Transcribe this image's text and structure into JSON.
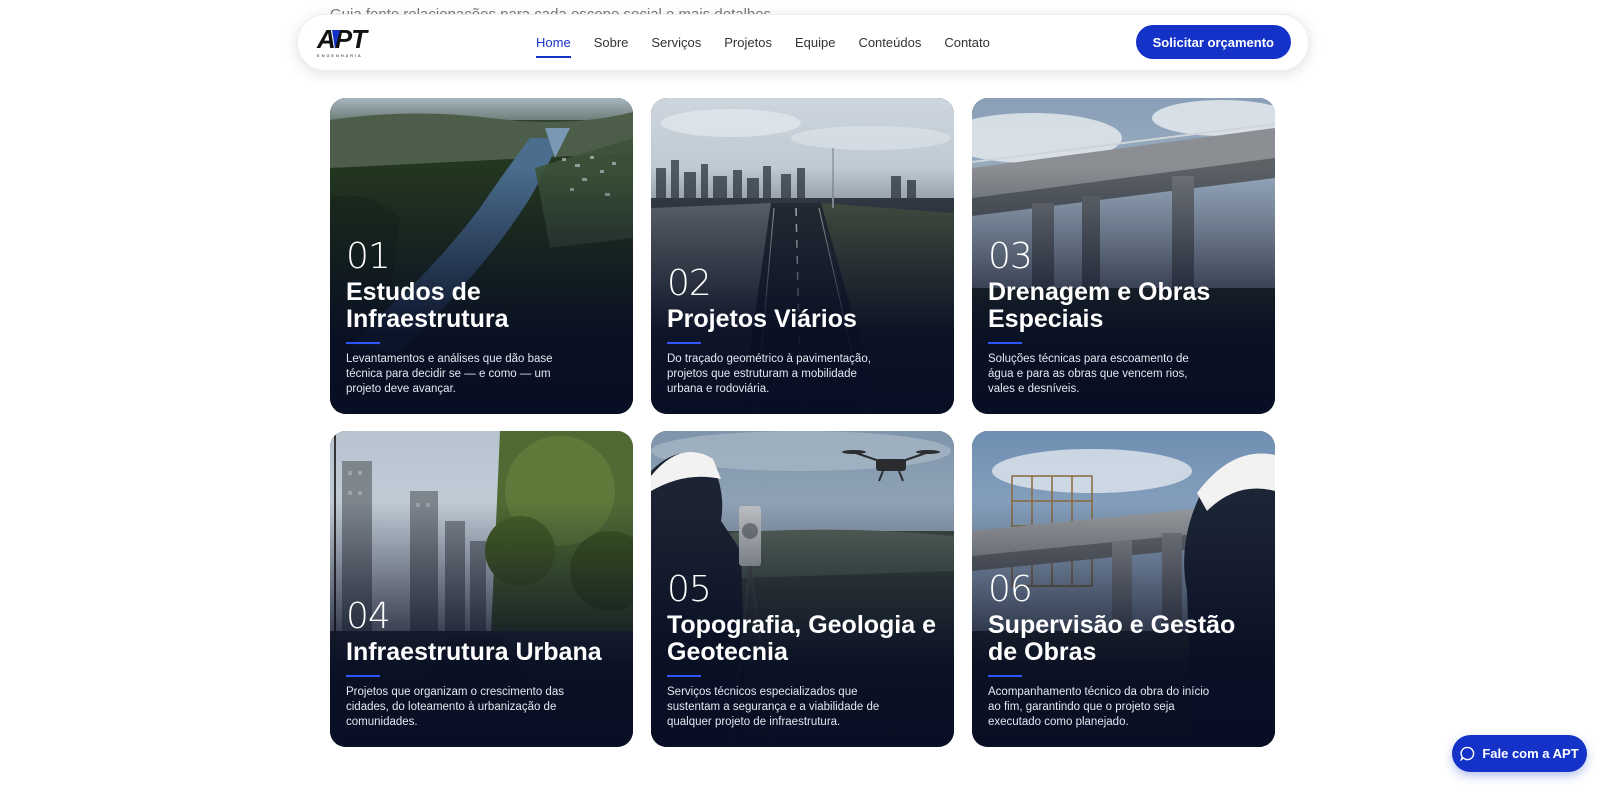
{
  "page": {
    "behind_text": "Guia fonte relacionações para cada escopo social e mais detalhes"
  },
  "header": {
    "logo_text": "APT",
    "logo_subtext": "ENGENHARIA",
    "nav": [
      {
        "label": "Home",
        "active": true
      },
      {
        "label": "Sobre"
      },
      {
        "label": "Serviços"
      },
      {
        "label": "Projetos"
      },
      {
        "label": "Equipe"
      },
      {
        "label": "Conteúdos"
      },
      {
        "label": "Contato"
      }
    ],
    "cta_label": "Solicitar orçamento"
  },
  "services": [
    {
      "number": "01",
      "title": "Estudos de Infraestrutura",
      "description": "Levantamentos e análises que dão base técnica para decidir se — e como — um projeto deve avançar."
    },
    {
      "number": "02",
      "title": "Projetos Viários",
      "description": "Do traçado geométrico à pavimentação, projetos que estruturam a mobilidade urbana e rodoviária."
    },
    {
      "number": "03",
      "title": "Drenagem e Obras Especiais",
      "description": "Soluções técnicas para escoamento de água e para as obras que vencem rios, vales e desníveis."
    },
    {
      "number": "04",
      "title": "Infraestrutura Urbana",
      "description": "Projetos que organizam o crescimento das cidades, do loteamento à urbanização de comunidades."
    },
    {
      "number": "05",
      "title": "Topografia, Geologia e Geotecnia",
      "description": "Serviços técnicos especializados que sustentam a segurança e a viabilidade de qualquer projeto de infraestrutura."
    },
    {
      "number": "06",
      "title": "Supervisão e Gestão de Obras",
      "description": "Acompanhamento técnico da obra do início ao fim, garantindo que o projeto seja executado como planejado."
    }
  ],
  "chat_button_label": "Fale com a APT",
  "colors": {
    "primary": "#1432c8",
    "accent_bar": "#2f55ff",
    "card_dark": "#080e23"
  }
}
